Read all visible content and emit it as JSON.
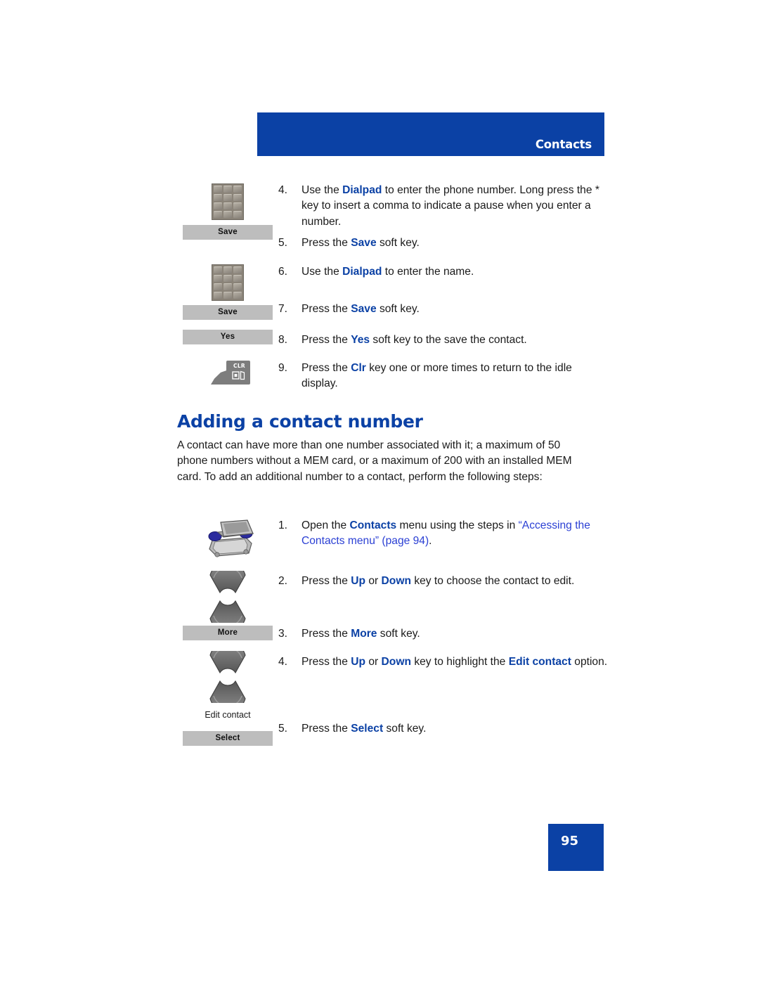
{
  "header": {
    "title": "Contacts",
    "bar_color": "#0b41a5"
  },
  "colors": {
    "brand_blue": "#0b41a5",
    "xref_blue": "#2a3fd4",
    "softkey_gray": "#bdbdbd",
    "text_black": "#1a1a1a"
  },
  "steps_top": [
    {
      "number": "4.",
      "parts": [
        {
          "t": "Use the ",
          "s": "plain"
        },
        {
          "t": "Dialpad",
          "s": "kw"
        },
        {
          "t": " to enter the phone number. Long press the * key to insert a comma to indicate a pause when you enter a number.",
          "s": "plain"
        }
      ]
    },
    {
      "number": "5.",
      "parts": [
        {
          "t": "Press the ",
          "s": "plain"
        },
        {
          "t": "Save",
          "s": "kw"
        },
        {
          "t": " soft key.",
          "s": "plain"
        }
      ]
    },
    {
      "number": "6.",
      "parts": [
        {
          "t": "Use the ",
          "s": "plain"
        },
        {
          "t": "Dialpad",
          "s": "kw"
        },
        {
          "t": " to enter the name.",
          "s": "plain"
        }
      ]
    },
    {
      "number": "7.",
      "parts": [
        {
          "t": "Press the ",
          "s": "plain"
        },
        {
          "t": "Save",
          "s": "kw"
        },
        {
          "t": " soft key.",
          "s": "plain"
        }
      ]
    },
    {
      "number": "8.",
      "parts": [
        {
          "t": "Press the ",
          "s": "plain"
        },
        {
          "t": "Yes",
          "s": "kw"
        },
        {
          "t": " soft key to the save the contact.",
          "s": "plain"
        }
      ]
    },
    {
      "number": "9.",
      "parts": [
        {
          "t": "Press the ",
          "s": "plain"
        },
        {
          "t": "Clr",
          "s": "kw"
        },
        {
          "t": " key one or more times to return to the idle display.",
          "s": "plain"
        }
      ]
    }
  ],
  "section": {
    "heading": "Adding a contact number",
    "paragraph": "A contact can have more than one number associated with it; a maximum of 50 phone numbers without a MEM card, or a maximum of 200 with an installed MEM card. To add an additional number to a contact, perform the following steps:"
  },
  "steps_bottom": [
    {
      "number": "1.",
      "parts": [
        {
          "t": "Open the ",
          "s": "plain"
        },
        {
          "t": "Contacts",
          "s": "kw"
        },
        {
          "t": " menu using the steps in ",
          "s": "plain"
        },
        {
          "t": "“Accessing the Contacts menu” (page 94)",
          "s": "xref"
        },
        {
          "t": ".",
          "s": "plain"
        }
      ]
    },
    {
      "number": "2.",
      "parts": [
        {
          "t": "Press the ",
          "s": "plain"
        },
        {
          "t": "Up",
          "s": "kw"
        },
        {
          "t": " or ",
          "s": "plain"
        },
        {
          "t": "Down",
          "s": "kw"
        },
        {
          "t": " key to choose the contact to edit.",
          "s": "plain"
        }
      ]
    },
    {
      "number": "3.",
      "parts": [
        {
          "t": "Press the ",
          "s": "plain"
        },
        {
          "t": "More",
          "s": "kw"
        },
        {
          "t": " soft key.",
          "s": "plain"
        }
      ]
    },
    {
      "number": "4.",
      "parts": [
        {
          "t": "Press the ",
          "s": "plain"
        },
        {
          "t": "Up",
          "s": "kw"
        },
        {
          "t": " or ",
          "s": "plain"
        },
        {
          "t": "Down",
          "s": "kw"
        },
        {
          "t": " key to highlight the ",
          "s": "plain"
        },
        {
          "t": "Edit contact",
          "s": "kw"
        },
        {
          "t": " option.",
          "s": "plain"
        }
      ]
    },
    {
      "number": "5.",
      "parts": [
        {
          "t": "Press the ",
          "s": "plain"
        },
        {
          "t": "Select",
          "s": "kw"
        },
        {
          "t": " soft key.",
          "s": "plain"
        }
      ]
    }
  ],
  "softkeys": {
    "save_1": "Save",
    "save_2": "Save",
    "yes": "Yes",
    "more": "More",
    "select": "Select"
  },
  "captions": {
    "edit_contact": "Edit contact"
  },
  "icons": {
    "dialpad_1": "dialpad-icon",
    "dialpad_2": "dialpad-icon",
    "clr_key": "clr-key-icon",
    "clr_label": "CLR",
    "contacts_key": "contacts-directory-icon",
    "nav_up_1": "nav-up-arc-icon",
    "nav_down_1": "nav-down-arc-icon",
    "nav_up_2": "nav-up-arc-icon",
    "nav_down_2": "nav-down-arc-icon"
  },
  "footer": {
    "page_number": "95"
  }
}
